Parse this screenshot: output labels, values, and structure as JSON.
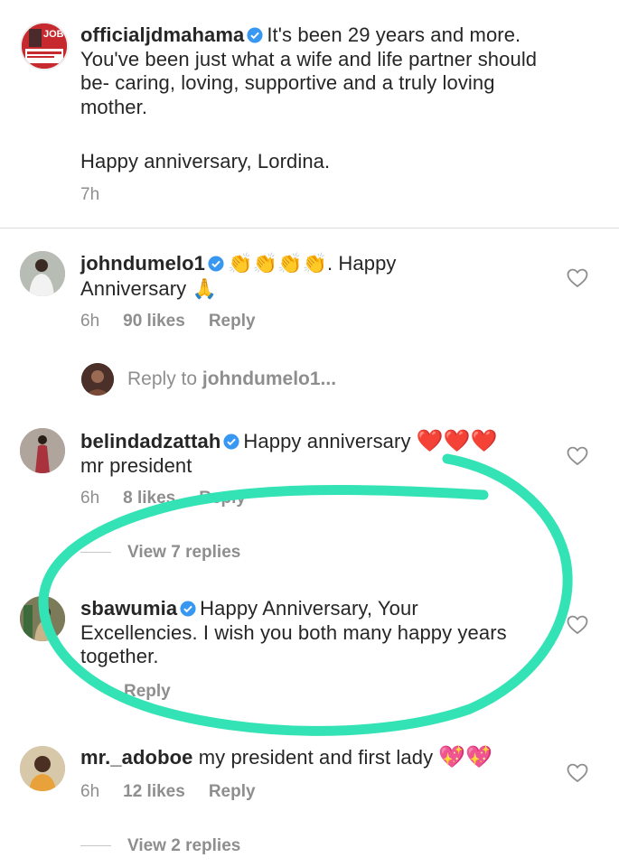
{
  "post": {
    "username": "officialjdmahama",
    "text_line1": "It's been 29 years and more.",
    "text_line2": "You've been just what a wife and life partner should",
    "text_line3": "be- caring, loving, supportive and a truly loving",
    "text_line4": "mother.",
    "text_line5": "Happy anniversary, Lordina.",
    "time": "7h",
    "avatar_text": "JOB"
  },
  "comments": [
    {
      "username": "johndumelo1",
      "emoji_claps": "👏👏👏👏",
      "text_a": ". Happy",
      "text_b": "Anniversary",
      "emoji_pray": "🙏",
      "time": "6h",
      "likes": "90 likes",
      "reply": "Reply"
    },
    {
      "username": "belindadzattah",
      "text_a": "Happy anniversary",
      "emoji_hearts": "❤️❤️❤️",
      "text_b": "mr president",
      "time": "6h",
      "likes": "8 likes",
      "reply": "Reply",
      "view_replies": "View 7 replies"
    },
    {
      "username": "sbawumia",
      "text_a": "Happy Anniversary, Your",
      "text_b": "Excellencies. I wish you both many happy years",
      "text_c": "together.",
      "reply": "Reply"
    },
    {
      "username": "mr._adoboe",
      "text_a": "my president and first lady",
      "emoji_hearts": "💖💖",
      "time": "6h",
      "likes": "12 likes",
      "reply": "Reply",
      "view_replies": "View 2 replies"
    }
  ],
  "reply_to": {
    "label": "Reply to",
    "target": "johndumelo1..."
  },
  "colors": {
    "annotation": "#33e3b5",
    "verified": "#3897f0",
    "meta": "#8e8e8e"
  }
}
